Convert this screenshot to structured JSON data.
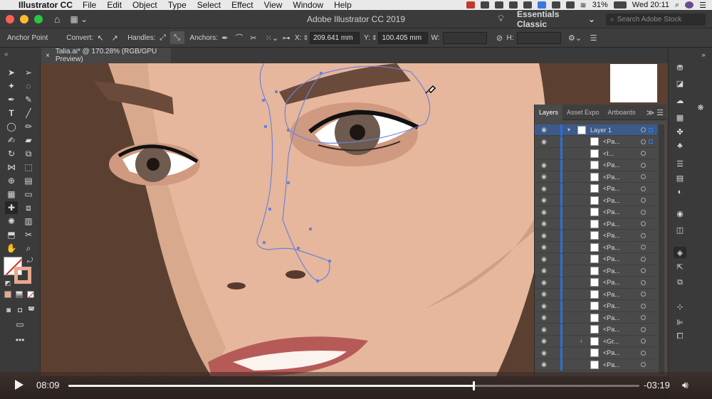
{
  "menubar": {
    "app_name": "Illustrator CC",
    "items": [
      "File",
      "Edit",
      "Object",
      "Type",
      "Select",
      "Effect",
      "View",
      "Window",
      "Help"
    ],
    "battery": "31%",
    "clock": "Wed 20:11"
  },
  "titlebar": {
    "title": "Adobe Illustrator CC 2019",
    "workspace": "Essentials Classic",
    "search_placeholder": "Search Adobe Stock"
  },
  "control": {
    "tool_label": "Anchor Point",
    "convert_label": "Convert:",
    "handles_label": "Handles:",
    "anchors_label": "Anchors:",
    "x_label": "X:",
    "x_value": "209.641 mm",
    "y_label": "Y:",
    "y_value": "100.405 mm",
    "w_label": "W:",
    "h_label": "H:"
  },
  "document": {
    "tab_title": "Talia.ai* @ 170.28% (RGB/GPU Preview)",
    "close_glyph": "×"
  },
  "layers": {
    "tabs": [
      "Layers",
      "Asset Expo",
      "Artboards"
    ],
    "active_tab": "Layers",
    "rows": [
      {
        "name": "Layer 1",
        "kind": "layer"
      },
      {
        "name": "<Pa...",
        "kind": "path"
      },
      {
        "name": "<I...",
        "kind": "image"
      },
      {
        "name": "<Pa...",
        "kind": "path"
      },
      {
        "name": "<Pa...",
        "kind": "path"
      },
      {
        "name": "<Pa...",
        "kind": "path"
      },
      {
        "name": "<Pa...",
        "kind": "path"
      },
      {
        "name": "<Pa...",
        "kind": "path"
      },
      {
        "name": "<Pa...",
        "kind": "path"
      },
      {
        "name": "<Pa...",
        "kind": "path"
      },
      {
        "name": "<Pa...",
        "kind": "path"
      },
      {
        "name": "<Pa...",
        "kind": "path"
      },
      {
        "name": "<Pa...",
        "kind": "path"
      },
      {
        "name": "<Pa...",
        "kind": "path"
      },
      {
        "name": "<Pa...",
        "kind": "path"
      },
      {
        "name": "<Pa...",
        "kind": "path"
      },
      {
        "name": "<Pa...",
        "kind": "path"
      },
      {
        "name": "<Pa...",
        "kind": "path"
      },
      {
        "name": "<Gr...",
        "kind": "group"
      },
      {
        "name": "<Pa...",
        "kind": "path"
      },
      {
        "name": "<Pa...",
        "kind": "path"
      }
    ]
  },
  "player": {
    "current_time": "08:09",
    "remaining_time": "-03:19",
    "progress": 0.71
  },
  "colors": {
    "accent": "#2d6fd6",
    "skin": "#e6b79c",
    "hair": "#5b4032",
    "lips": "#b65a58",
    "path_stroke": "#6f82d8"
  }
}
